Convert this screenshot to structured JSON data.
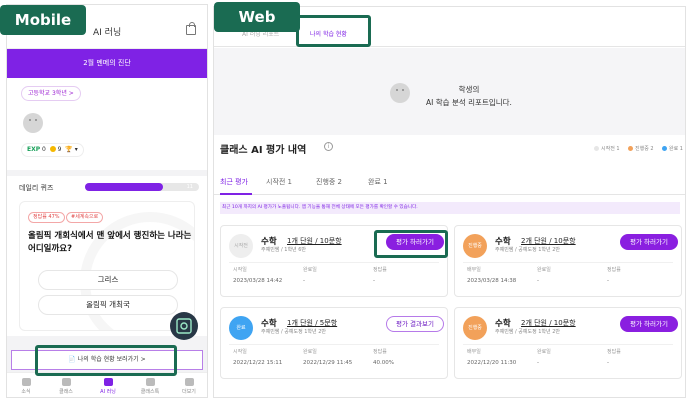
{
  "labels": {
    "mobile": "Mobile",
    "web": "Web"
  },
  "mobile": {
    "header_title": "AI 러닝",
    "banner": "2월 멘메의 진단",
    "grade_chip": "고등학교 3학년 >",
    "stats": {
      "exp_label": "EXP",
      "exp_value": "0",
      "coins": "9",
      "trophy": "▾"
    },
    "quiz": {
      "title": "데일리 퀴즈",
      "progress_value": 11,
      "progress_fraction": 0.68,
      "tag_rate": "정답률 47%",
      "tag_topic": "#세계속으로",
      "question": "올림픽 개회식에서 맨 앞에서 행진하는 나라는 어디일까요?",
      "options": [
        "그리스",
        "올림픽 개최국"
      ]
    },
    "status_button": "나의 학습 현황 보러가기 >",
    "nav": [
      "소식",
      "클래스",
      "AI 러닝",
      "클래스톡",
      "더보기"
    ]
  },
  "web": {
    "tabs": [
      "AI 러닝 리포트",
      "나의 학습 현황"
    ],
    "hero_line1": "학생의",
    "hero_line2": "AI 학습 분석 리포트입니다.",
    "section_title": "클래스 AI 평가 내역",
    "legend": [
      "시작전 1",
      "진행중 2",
      "완료 1"
    ],
    "filter_tabs": [
      "최근 평가",
      "시작전 1",
      "진행중 2",
      "완료 1"
    ],
    "notice": "최근 10개 까지의 AI 평가가 노출됩니다. 앱 기능을 통해 전체 상태에 모든 평가를 확인할 수 있습니다.",
    "cards": [
      {
        "status": "시작전",
        "subject": "수학",
        "units": "1개 단원 / 10문항",
        "meta": "주예빈쌤 / 1학년 6반",
        "button": "평가 하러가기",
        "col_heads": [
          "시작일",
          "완료일",
          "정답률"
        ],
        "col_vals": [
          "2023/03/28 14:42",
          "-",
          "-"
        ]
      },
      {
        "status": "진행중",
        "subject": "수학",
        "units": "2개 단원 / 10문항",
        "meta": "주예빈쌤 / 공예도정 1학년 2반",
        "button": "평가 하러가기",
        "col_heads": [
          "배부일",
          "완료일",
          "정답률"
        ],
        "col_vals": [
          "2023/03/28 14:38",
          "-",
          "-"
        ]
      },
      {
        "status": "완료",
        "subject": "수학",
        "units": "1개 단원 / 5문항",
        "meta": "주예빈쌤 / 공예도정 1학년 2반",
        "button": "평가 결과보기",
        "col_heads": [
          "시작일",
          "완료일",
          "정답률"
        ],
        "col_vals": [
          "2022/12/22 15:11",
          "2022/12/29 11:45",
          "40.00%"
        ]
      },
      {
        "status": "진행중",
        "subject": "수학",
        "units": "2개 단원 / 10문항",
        "meta": "주예빈쌤 / 공예도정 1학년 2반",
        "button": "평가 하러가기",
        "col_heads": [
          "배부일",
          "완료일",
          "정답률"
        ],
        "col_vals": [
          "2022/12/20 11:30",
          "-",
          "-"
        ]
      }
    ]
  },
  "colors": {
    "accent": "#7f22e5",
    "highlight": "#1a6b52",
    "in_progress": "#f2a15a",
    "done": "#3fa4f2",
    "not_started": "#eeeeee"
  }
}
